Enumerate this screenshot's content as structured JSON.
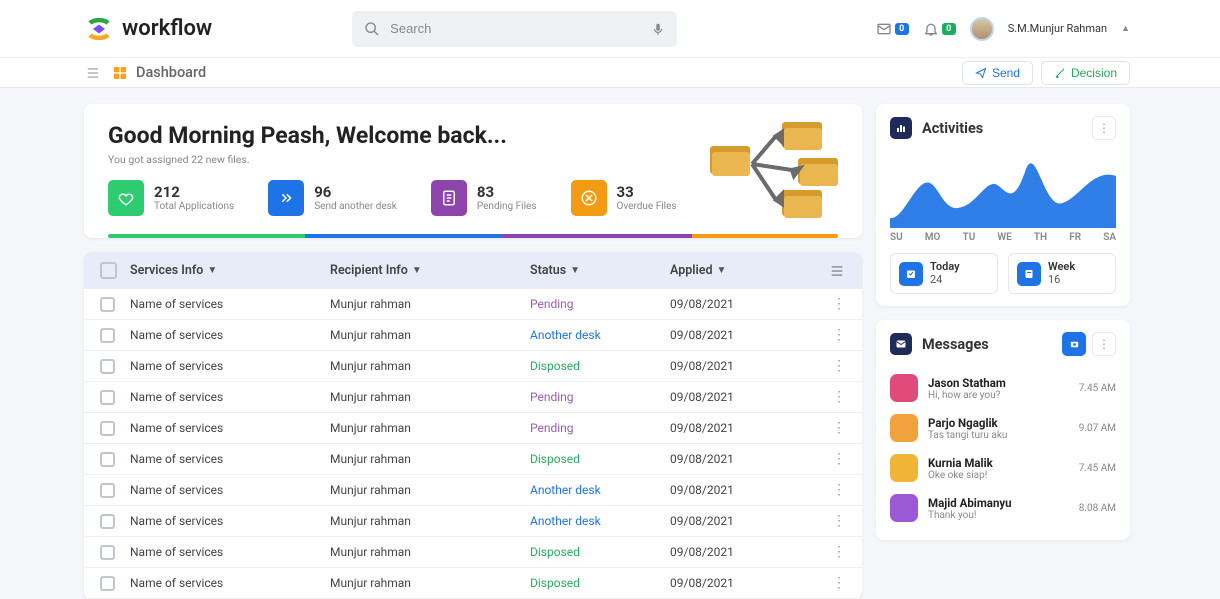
{
  "brand": {
    "name": "workflow"
  },
  "search_placeholder": "Search",
  "topbar": {
    "messages_badge": "0",
    "alerts_badge": "0",
    "user_name": "S.M.Munjur Rahman"
  },
  "subbar": {
    "page_title": "Dashboard",
    "send_label": "Send",
    "decision_label": "Decision"
  },
  "welcome": {
    "greeting": "Good Morning Peash, Welcome back...",
    "subtitle": "You got assigned 22 new files.",
    "stats": [
      {
        "value": "212",
        "label": "Total Applications"
      },
      {
        "value": "96",
        "label": "Send another desk"
      },
      {
        "value": "83",
        "label": "Pending Files"
      },
      {
        "value": "33",
        "label": "Overdue Files"
      }
    ]
  },
  "table": {
    "headers": {
      "services": "Services Info",
      "recipient": "Recipient Info",
      "status": "Status",
      "applied": "Applied"
    },
    "rows": [
      {
        "service": "Name of services",
        "recipient": "Munjur rahman",
        "status": "Pending",
        "applied": "09/08/2021"
      },
      {
        "service": "Name of services",
        "recipient": "Munjur rahman",
        "status": "Another desk",
        "applied": "09/08/2021"
      },
      {
        "service": "Name of services",
        "recipient": "Munjur rahman",
        "status": "Disposed",
        "applied": "09/08/2021"
      },
      {
        "service": "Name of services",
        "recipient": "Munjur rahman",
        "status": "Pending",
        "applied": "09/08/2021"
      },
      {
        "service": "Name of services",
        "recipient": "Munjur rahman",
        "status": "Pending",
        "applied": "09/08/2021"
      },
      {
        "service": "Name of services",
        "recipient": "Munjur rahman",
        "status": "Disposed",
        "applied": "09/08/2021"
      },
      {
        "service": "Name of services",
        "recipient": "Munjur rahman",
        "status": "Another desk",
        "applied": "09/08/2021"
      },
      {
        "service": "Name of services",
        "recipient": "Munjur rahman",
        "status": "Another desk",
        "applied": "09/08/2021"
      },
      {
        "service": "Name of services",
        "recipient": "Munjur rahman",
        "status": "Disposed",
        "applied": "09/08/2021"
      },
      {
        "service": "Name of services",
        "recipient": "Munjur rahman",
        "status": "Disposed",
        "applied": "09/08/2021"
      }
    ]
  },
  "activities": {
    "title": "Activities",
    "days": [
      "SU",
      "MO",
      "TU",
      "WE",
      "TH",
      "FR",
      "SA"
    ],
    "today_label": "Today",
    "today_value": "24",
    "week_label": "Week",
    "week_value": "16"
  },
  "messages": {
    "title": "Messages",
    "items": [
      {
        "name": "Jason Statham",
        "text": "Hi, how are you?",
        "time": "7.45 AM"
      },
      {
        "name": "Parjo Ngaglik",
        "text": "Tas tangi turu aku",
        "time": "9.07 AM"
      },
      {
        "name": "Kurnia Malik",
        "text": "Oke oke siap!",
        "time": "7.45 AM"
      },
      {
        "name": "Majid Abimanyu",
        "text": "Thank you!",
        "time": "8.08 AM"
      }
    ]
  },
  "chart_data": {
    "type": "area",
    "categories": [
      "SU",
      "MO",
      "TU",
      "WE",
      "TH",
      "FR",
      "SA"
    ],
    "values": [
      20,
      55,
      30,
      50,
      85,
      35,
      70
    ],
    "ylim": [
      0,
      100
    ]
  }
}
